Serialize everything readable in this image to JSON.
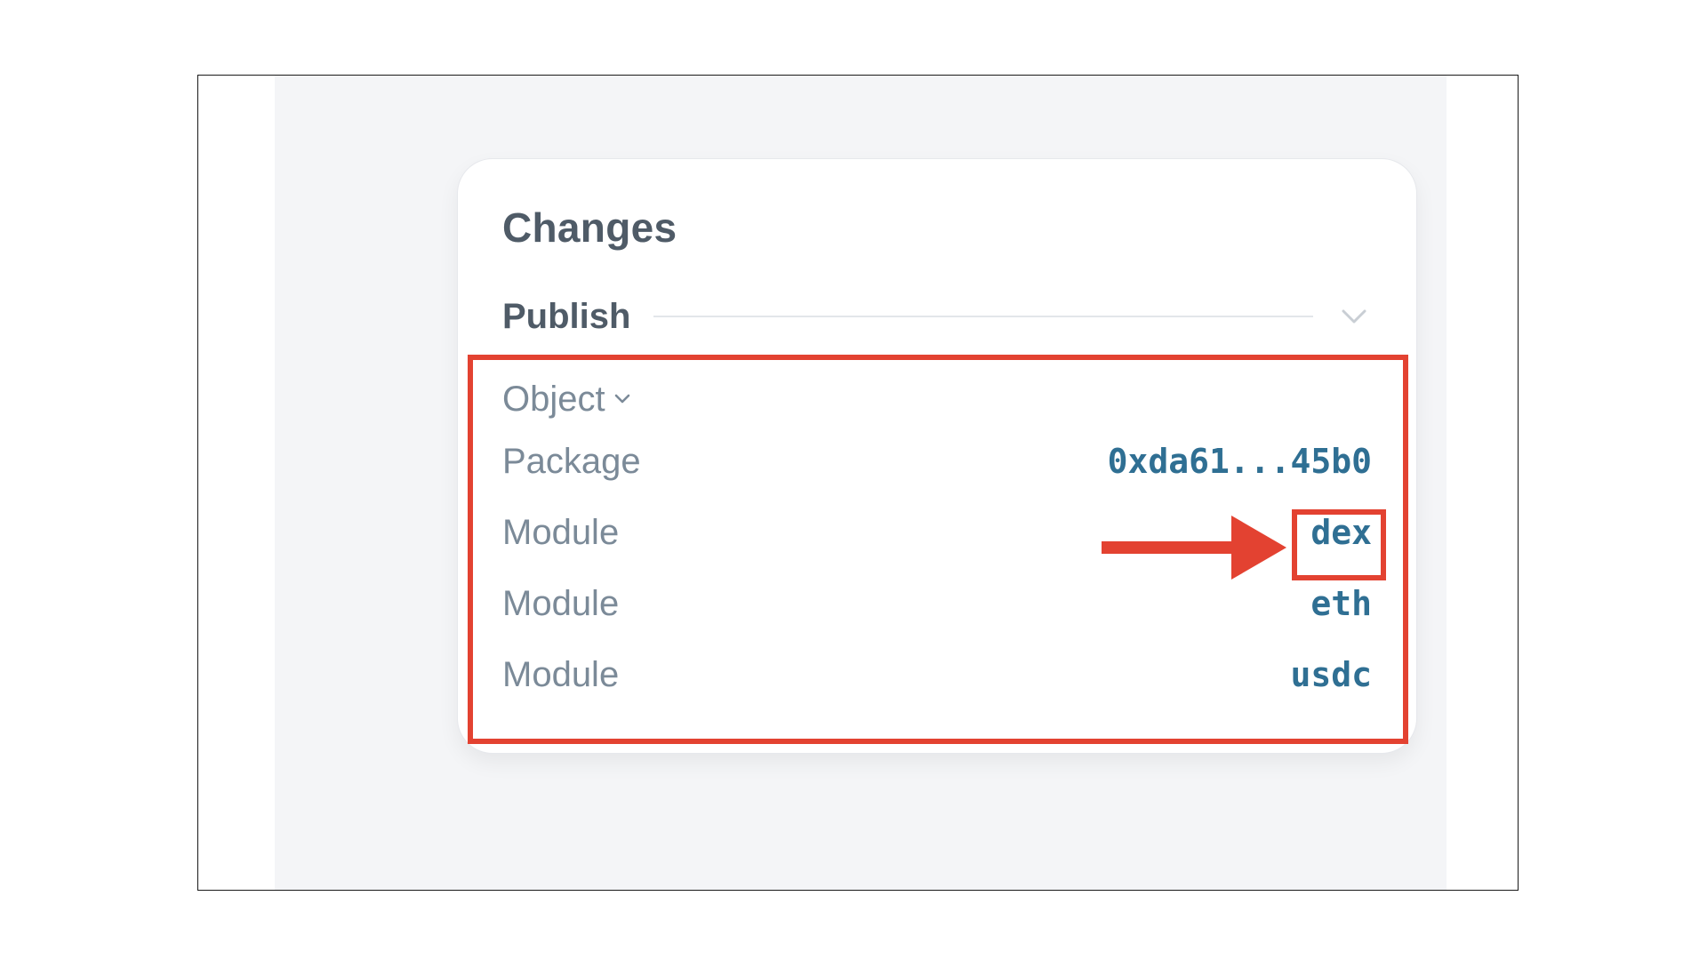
{
  "panel": {
    "title": "Changes",
    "section_label": "Publish"
  },
  "object_toggle": {
    "label": "Object"
  },
  "rows": [
    {
      "label": "Package",
      "value": "0xda61...45b0"
    },
    {
      "label": "Module",
      "value": "dex"
    },
    {
      "label": "Module",
      "value": "eth"
    },
    {
      "label": "Module",
      "value": "usdc"
    }
  ],
  "colors": {
    "annotation": "#e34231",
    "value_link": "#2f6f93",
    "label_text": "#7b8a98",
    "heading_text": "#4f5b67",
    "background_panel": "#f4f5f7"
  },
  "icons": {
    "section_toggle": "chevron-down-icon",
    "object_toggle": "chevron-down-icon",
    "annotation_pointer": "arrow-right-icon"
  }
}
